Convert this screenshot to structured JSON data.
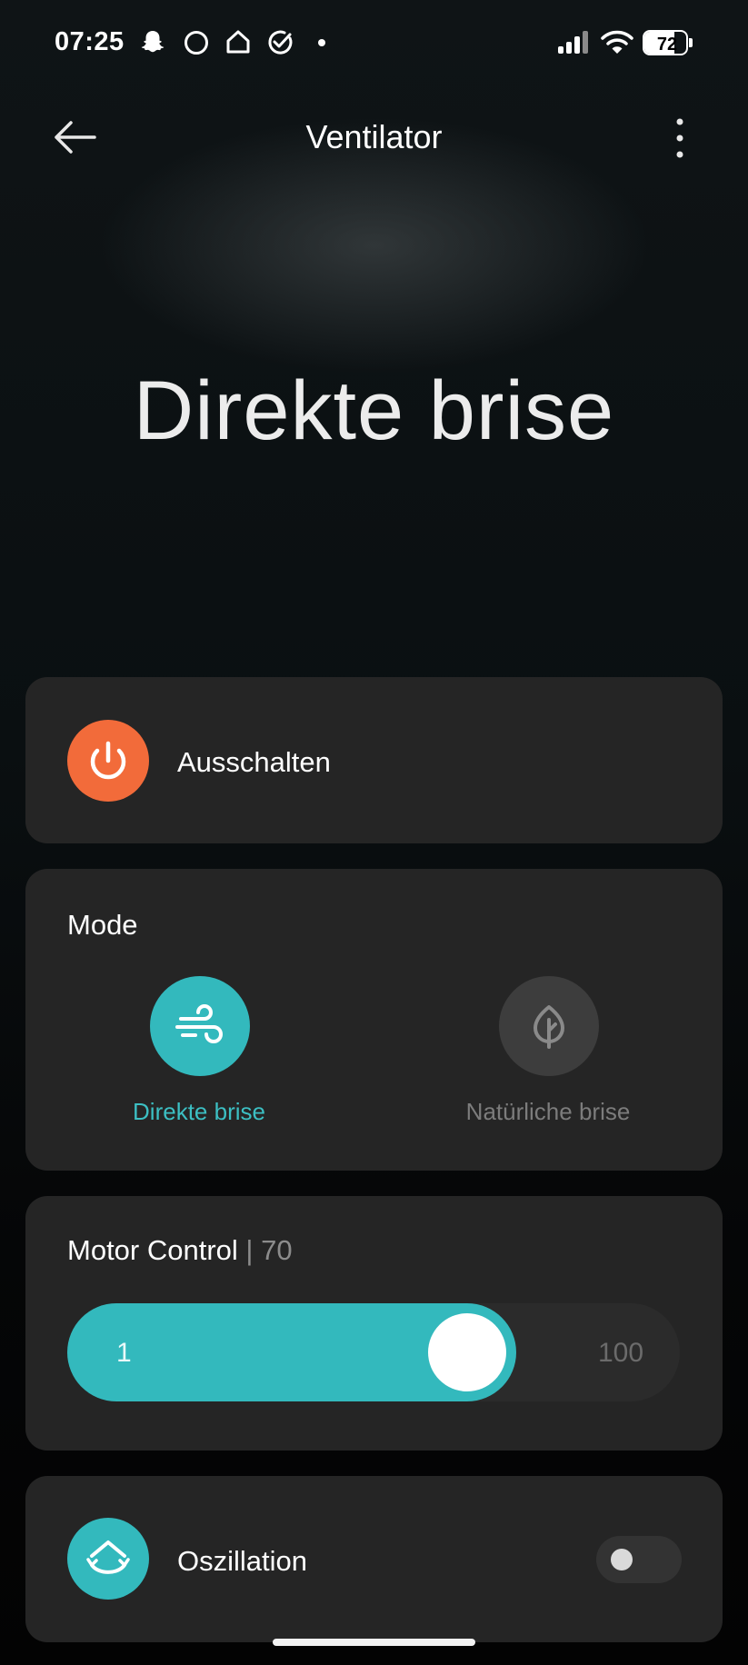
{
  "status_bar": {
    "time": "07:25",
    "battery": "72",
    "battery_level": 0.72,
    "icons": [
      "snapchat-icon",
      "circle-icon",
      "home-icon",
      "check-circle-icon",
      "dot-icon",
      "signal-icon",
      "wifi-icon",
      "battery-icon"
    ]
  },
  "app_bar": {
    "title": "Ventilator"
  },
  "hero": {
    "mode_text": "Direkte brise"
  },
  "power": {
    "label": "Ausschalten",
    "color": "#f26b3a"
  },
  "mode": {
    "title": "Mode",
    "options": [
      {
        "label": "Direkte brise",
        "selected": true
      },
      {
        "label": "Natürliche brise",
        "selected": false
      }
    ]
  },
  "motor": {
    "title": "Motor Control",
    "separator": "|",
    "value": "70",
    "min_label": "1",
    "max_label": "100",
    "min": 1,
    "max": 100,
    "current": 70
  },
  "oscillation": {
    "label": "Oszillation",
    "enabled": false
  },
  "colors": {
    "accent": "#33b9bd",
    "card": "#252525"
  }
}
